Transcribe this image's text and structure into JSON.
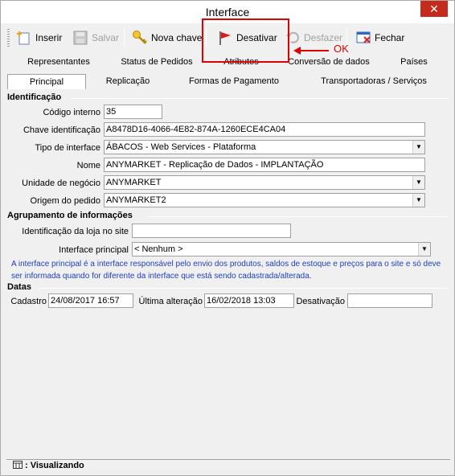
{
  "window": {
    "title": "Interface",
    "close_glyph": "✕"
  },
  "toolbar": {
    "insert_label": "Inserir",
    "save_label": "Salvar",
    "new_key_label": "Nova chave",
    "deactivate_label": "Desativar",
    "undo_label": "Desfazer",
    "close_label": "Fechar"
  },
  "annotation": {
    "ok_text": "OK",
    "color": "#e00000"
  },
  "tabs_row1": [
    "Representantes",
    "Status de Pedidos",
    "Atributos",
    "Conversão de dados",
    "Países"
  ],
  "tabs_row2": [
    "Principal",
    "Replicação",
    "Formas de Pagamento",
    "Transportadoras / Serviços"
  ],
  "sections": {
    "identificacao": "Identificação",
    "agrupamento": "Agrupamento de informações",
    "datas": "Datas"
  },
  "fields": {
    "codigo_label": "Código interno",
    "codigo_value": "35",
    "chave_label": "Chave identificação",
    "chave_value": "A8478D16-4066-4E82-874A-1260ECE4CA04",
    "tipo_label": "Tipo de interface",
    "tipo_value": "ÁBACOS - Web Services - Plataforma",
    "nome_label": "Nome",
    "nome_value": "ANYMARKET - Replicação de Dados - IMPLANTAÇÃO",
    "unidade_label": "Unidade de negócio",
    "unidade_value": "ANYMARKET",
    "origem_label": "Origem do pedido",
    "origem_value": "ANYMARKET2",
    "loja_label": "Identificação da loja no site",
    "loja_value": "",
    "interface_principal_label": "Interface principal",
    "interface_principal_value": "< Nenhum >",
    "cadastro_label": "Cadastro",
    "cadastro_value": "24/08/2017 16:57",
    "ultima_label": "Última alteração",
    "ultima_value": "16/02/2018 13:03",
    "desativacao_label": "Desativação",
    "desativacao_value": ""
  },
  "info_text": "A interface principal é a interface responsável pelo envio dos produtos, saldos de estoque e preços para o site e só deve ser informada quando for diferente da interface que está sendo cadastrada/alterada.",
  "status": {
    "text": ": Visualizando"
  },
  "colors": {
    "info_blue": "#1f3fbf",
    "disabled": "#a0a0a0",
    "highlight_red": "#e00000"
  }
}
